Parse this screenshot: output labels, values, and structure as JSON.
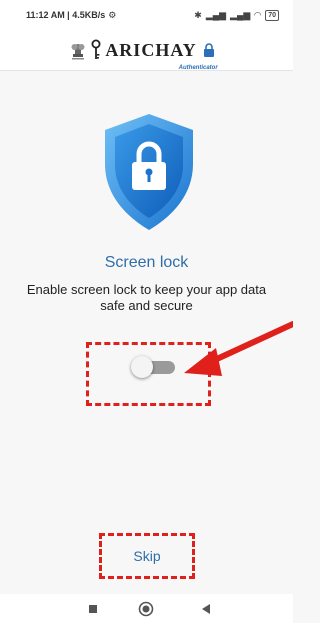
{
  "status_bar": {
    "time_speed": "11:12 AM | 4.5KB/s",
    "battery": "70"
  },
  "header": {
    "brand": "ARICHAY",
    "tagline": "Authenticator"
  },
  "screen": {
    "title": "Screen lock",
    "description": "Enable screen lock to keep your app data safe and secure",
    "toggle_state": "off"
  },
  "actions": {
    "skip_label": "Skip"
  },
  "colors": {
    "accent_blue": "#2f6ea8",
    "shield_blue": "#1f7fd6",
    "annotation_red": "#e0201a"
  },
  "icons": {
    "shield": "shield-lock-icon",
    "nav_back": "back-triangle-icon",
    "nav_home": "home-circle-icon",
    "nav_recents": "recents-square-icon"
  }
}
